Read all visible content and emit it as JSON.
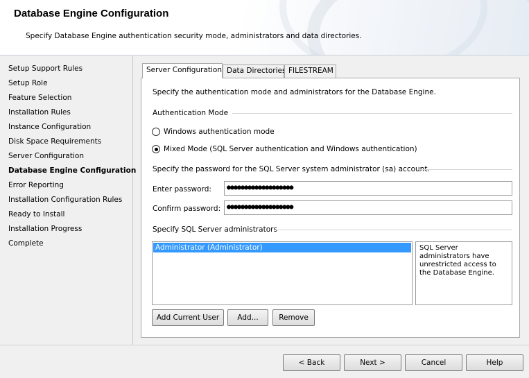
{
  "header": {
    "title": "Database Engine Configuration",
    "subtitle": "Specify Database Engine authentication security mode, administrators and data directories."
  },
  "sidebar": {
    "items": [
      {
        "label": "Setup Support Rules",
        "active": false
      },
      {
        "label": "Setup Role",
        "active": false
      },
      {
        "label": "Feature Selection",
        "active": false
      },
      {
        "label": "Installation Rules",
        "active": false
      },
      {
        "label": "Instance Configuration",
        "active": false
      },
      {
        "label": "Disk Space Requirements",
        "active": false
      },
      {
        "label": "Server Configuration",
        "active": false
      },
      {
        "label": "Database Engine Configuration",
        "active": true
      },
      {
        "label": "Error Reporting",
        "active": false
      },
      {
        "label": "Installation Configuration Rules",
        "active": false
      },
      {
        "label": "Ready to Install",
        "active": false
      },
      {
        "label": "Installation Progress",
        "active": false
      },
      {
        "label": "Complete",
        "active": false
      }
    ]
  },
  "tabs": [
    {
      "label": "Server Configuration",
      "selected": true
    },
    {
      "label": "Data Directories",
      "selected": false
    },
    {
      "label": "FILESTREAM",
      "selected": false
    }
  ],
  "panel": {
    "intro": "Specify the authentication mode and administrators for the Database Engine.",
    "auth_group_label": "Authentication Mode",
    "radio_windows": {
      "label": "Windows authentication mode",
      "selected": false
    },
    "radio_mixed": {
      "label": "Mixed Mode (SQL Server authentication and Windows authentication)",
      "selected": true
    },
    "sa_group_label": "Specify the password for the SQL Server system administrator (sa) account.",
    "enter_password_label": "Enter password:",
    "enter_password_value": "●●●●●●●●●●●●●●●●●●●",
    "confirm_password_label": "Confirm password:",
    "confirm_password_value": "●●●●●●●●●●●●●●●●●●●",
    "admins_group_label": "Specify SQL Server administrators",
    "admins": [
      "Administrator (Administrator)"
    ],
    "admins_info": "SQL Server administrators have unrestricted access to the Database Engine.",
    "add_current_user_label": "Add Current User",
    "add_label": "Add...",
    "remove_label": "Remove"
  },
  "footer": {
    "back_label": "< Back",
    "next_label": "Next >",
    "cancel_label": "Cancel",
    "help_label": "Help"
  }
}
